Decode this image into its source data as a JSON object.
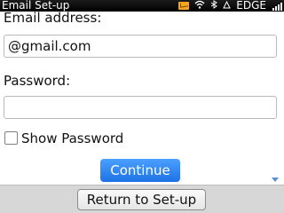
{
  "statusbar": {
    "title": "Email Set-up",
    "network": "EDGE"
  },
  "form": {
    "email_label": "Email address:",
    "email_value": "@gmail.com",
    "password_label": "Password:",
    "password_value": "",
    "show_password_label": "Show Password",
    "show_password_checked": false,
    "continue_label": "Continue"
  },
  "footer": {
    "return_label": "Return to Set-up"
  },
  "colors": {
    "accent": "#2f86f2",
    "badge": "#f5a623"
  },
  "icons": [
    "mail-badge-icon",
    "wifi-icon",
    "bluetooth-icon",
    "roaming-triangle-icon",
    "signal-bars-icon",
    "scroll-down-icon"
  ]
}
